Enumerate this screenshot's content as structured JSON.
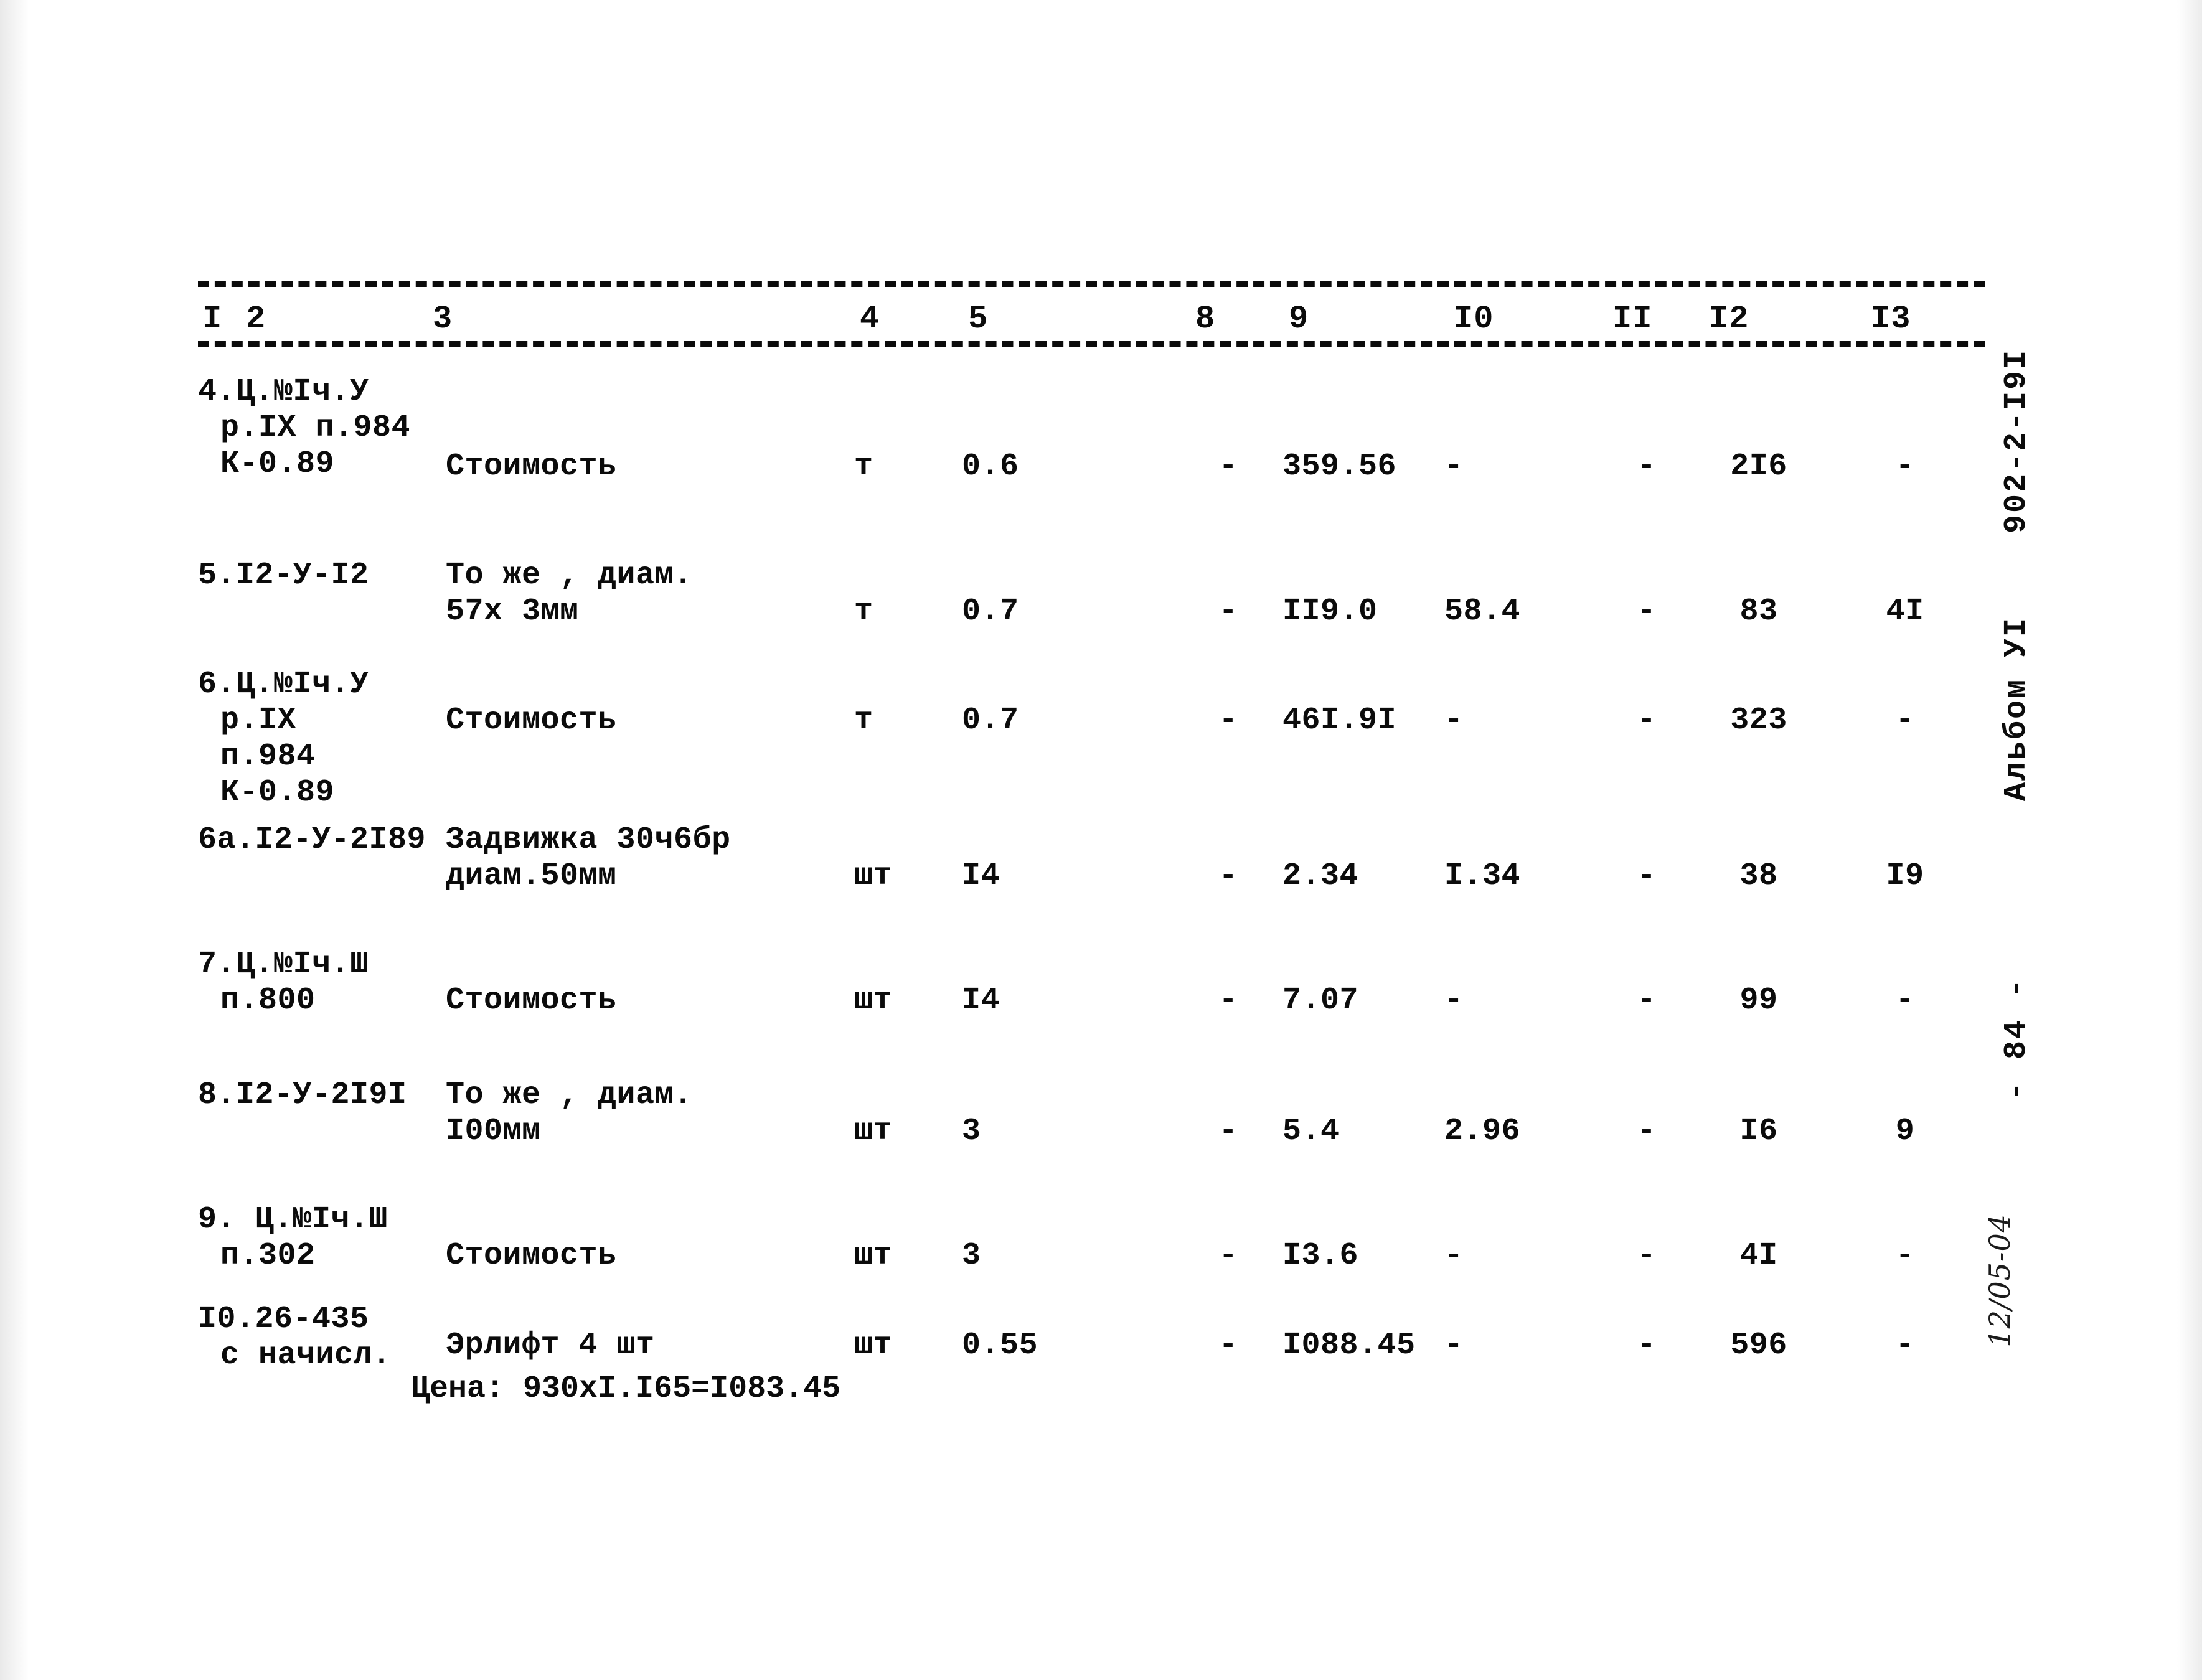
{
  "document": {
    "sheet_code": "902-2-I9I",
    "album": "Альбом УI",
    "page_number": "- 84 -",
    "handwritten_stamp": "12/05-04"
  },
  "table": {
    "column_headers": [
      "I",
      "2",
      "3",
      "4",
      "5",
      "8",
      "9",
      "I0",
      "II",
      "I2",
      "I3"
    ],
    "rows": [
      {
        "code_lines": [
          "4.Ц.№Iч.У",
          "р.IX п.984",
          "К-0.89"
        ],
        "name_lines": [
          "Стоимость"
        ],
        "unit": "т",
        "qty": "0.6",
        "c8": "-",
        "c9": "359.56",
        "c10": "-",
        "c11": "-",
        "c12": "2I6",
        "c13": "-"
      },
      {
        "code_lines": [
          "5.I2-У-I2"
        ],
        "name_lines": [
          "То же , диам.",
          "57х 3мм"
        ],
        "unit": "т",
        "qty": "0.7",
        "c8": "-",
        "c9": "II9.0",
        "c10": "58.4",
        "c11": "-",
        "c12": "83",
        "c13": "4I"
      },
      {
        "code_lines": [
          "6.Ц.№Iч.У",
          "р.IX",
          "п.984",
          "К-0.89"
        ],
        "name_lines": [
          "Стоимость"
        ],
        "unit": "т",
        "qty": "0.7",
        "c8": "-",
        "c9": "46I.9I",
        "c10": "-",
        "c11": "-",
        "c12": "323",
        "c13": "-"
      },
      {
        "code_lines": [
          "6а.I2-У-2I89"
        ],
        "name_lines": [
          "Задвижка 30ч6бр",
          "диам.50мм"
        ],
        "unit": "шт",
        "qty": "I4",
        "c8": "-",
        "c9": "2.34",
        "c10": "I.34",
        "c11": "-",
        "c12": "38",
        "c13": "I9"
      },
      {
        "code_lines": [
          "7.Ц.№Iч.Ш",
          "п.800"
        ],
        "name_lines": [
          "Стоимость"
        ],
        "unit": "шт",
        "qty": "I4",
        "c8": "-",
        "c9": "7.07",
        "c10": "-",
        "c11": "-",
        "c12": "99",
        "c13": "-"
      },
      {
        "code_lines": [
          "8.I2-У-2I9I"
        ],
        "name_lines": [
          "То же , диам.",
          "I00мм"
        ],
        "unit": "шт",
        "qty": "3",
        "c8": "-",
        "c9": "5.4",
        "c10": "2.96",
        "c11": "-",
        "c12": "I6",
        "c13": "9"
      },
      {
        "code_lines": [
          "9. Ц.№Iч.Ш",
          "п.302"
        ],
        "name_lines": [
          "Стоимость"
        ],
        "unit": "шт",
        "qty": "3",
        "c8": "-",
        "c9": "I3.6",
        "c10": "-",
        "c11": "-",
        "c12": "4I",
        "c13": "-"
      },
      {
        "code_lines": [
          "I0.26-435",
          "с начисл."
        ],
        "name_lines": [
          "Эрлифт 4 шт"
        ],
        "unit": "шт",
        "qty": "0.55",
        "c8": "-",
        "c9": "I088.45",
        "c10": "-",
        "c11": "-",
        "c12": "596",
        "c13": "-"
      }
    ],
    "footnote": "Цена: 930хI.I65=I083.45"
  }
}
